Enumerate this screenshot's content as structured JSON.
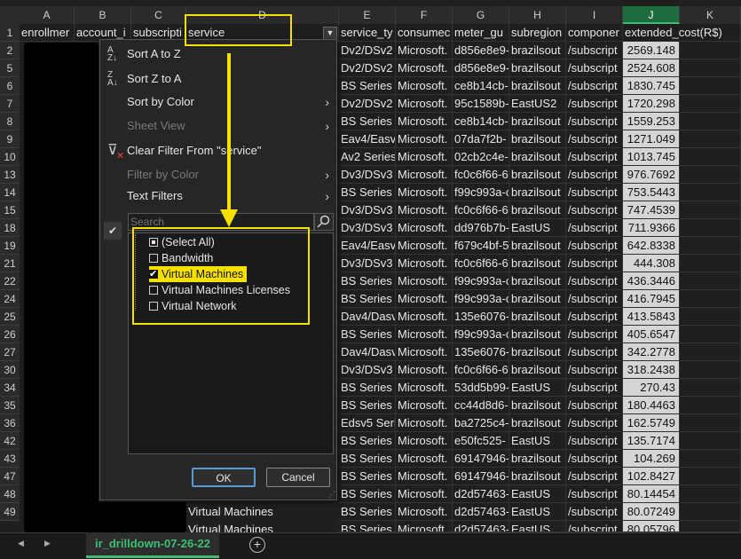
{
  "column_letters": [
    "A",
    "B",
    "C",
    "D",
    "E",
    "F",
    "G",
    "H",
    "I",
    "J",
    "K"
  ],
  "row_numbers": [
    "1",
    "2",
    "5",
    "6",
    "7",
    "8",
    "9",
    "10",
    "13",
    "14",
    "15",
    "18",
    "19",
    "21",
    "22",
    "24",
    "25",
    "26",
    "27",
    "30",
    "34",
    "35",
    "36",
    "42",
    "43",
    "47",
    "48",
    "49"
  ],
  "headers": {
    "A": "enrollmer",
    "B": "account_i",
    "C": "subscripti",
    "D": "service",
    "E": "service_ty",
    "F": "consumec",
    "G": "meter_gu",
    "H": "subregion",
    "I": "componer",
    "J": "extended_cost(R$)"
  },
  "rows": [
    [
      "Dv2/DSv2",
      "Microsoft.",
      "d856e8e9-",
      "brazilsout",
      "/subscript",
      "2569.148"
    ],
    [
      "Dv2/DSv2",
      "Microsoft.",
      "d856e8e9-",
      "brazilsout",
      "/subscript",
      "2524.608"
    ],
    [
      "BS Series",
      "Microsoft.",
      "ce8b14cb-",
      "brazilsout",
      "/subscript",
      "1830.745"
    ],
    [
      "Dv2/DSv2",
      "Microsoft.",
      "95c1589b-",
      "EastUS2",
      "/subscript",
      "1720.298"
    ],
    [
      "BS Series",
      "Microsoft.",
      "ce8b14cb-",
      "brazilsout",
      "/subscript",
      "1559.253"
    ],
    [
      "Eav4/Easv",
      "Microsoft.",
      "07da7f2b-",
      "brazilsout",
      "/subscript",
      "1271.049"
    ],
    [
      "Av2 Series",
      "Microsoft.",
      "02cb2c4e-",
      "brazilsout",
      "/subscript",
      "1013.745"
    ],
    [
      "Dv3/DSv3",
      "Microsoft.",
      "fc0c6f66-6",
      "brazilsout",
      "/subscript",
      "976.7692"
    ],
    [
      "BS Series",
      "Microsoft.",
      "f99c993a-c",
      "brazilsout",
      "/subscript",
      "753.5443"
    ],
    [
      "Dv3/DSv3",
      "Microsoft.",
      "fc0c6f66-6",
      "brazilsout",
      "/subscript",
      "747.4539"
    ],
    [
      "Dv3/DSv3",
      "Microsoft.",
      "dd976b7b-",
      "EastUS",
      "/subscript",
      "711.9366"
    ],
    [
      "Eav4/Easv",
      "Microsoft.",
      "f679c4bf-5",
      "brazilsout",
      "/subscript",
      "642.8338"
    ],
    [
      "Dv3/DSv3",
      "Microsoft.",
      "fc0c6f66-6",
      "brazilsout",
      "/subscript",
      "444.308"
    ],
    [
      "BS Series",
      "Microsoft.",
      "f99c993a-c",
      "brazilsout",
      "/subscript",
      "436.3446"
    ],
    [
      "BS Series",
      "Microsoft.",
      "f99c993a-c",
      "brazilsout",
      "/subscript",
      "416.7945"
    ],
    [
      "Dav4/Dasv",
      "Microsoft.",
      "135e6076-",
      "brazilsout",
      "/subscript",
      "413.5843"
    ],
    [
      "BS Series",
      "Microsoft.",
      "f99c993a-c",
      "brazilsout",
      "/subscript",
      "405.6547"
    ],
    [
      "Dav4/Dasv",
      "Microsoft.",
      "135e6076-",
      "brazilsout",
      "/subscript",
      "342.2778"
    ],
    [
      "Dv3/DSv3",
      "Microsoft.",
      "fc0c6f66-6",
      "brazilsout",
      "/subscript",
      "318.2438"
    ],
    [
      "BS Series",
      "Microsoft.",
      "53dd5b99-",
      "EastUS",
      "/subscript",
      "270.43"
    ],
    [
      "BS Series",
      "Microsoft.",
      "cc44d8d6-",
      "brazilsout",
      "/subscript",
      "180.4463"
    ],
    [
      "Edsv5 Seri",
      "Microsoft.",
      "ba2725c4-",
      "brazilsout",
      "/subscript",
      "162.5749"
    ],
    [
      "BS Series",
      "Microsoft.",
      "e50fc525-",
      "EastUS",
      "/subscript",
      "135.7174"
    ],
    [
      "BS Series",
      "Microsoft.",
      "69147946-",
      "brazilsout",
      "/subscript",
      "104.269"
    ],
    [
      "BS Series",
      "Microsoft.",
      "69147946-",
      "brazilsout",
      "/subscript",
      "102.8427"
    ],
    [
      "BS Series",
      "Microsoft.",
      "d2d57463-",
      "EastUS",
      "/subscript",
      "80.14454"
    ],
    [
      "BS Series",
      "Microsoft.",
      "d2d57463-",
      "EastUS",
      "/subscript",
      "80.07249"
    ],
    [
      "BS Series",
      "Microsoft.",
      "d2d57463-",
      "EastUS",
      "/subscript",
      "80.05796"
    ]
  ],
  "visible_service_cells": [
    "Virtual Machines",
    "Virtual Machines"
  ],
  "filter_menu": {
    "sort_az": "Sort A to Z",
    "sort_za": "Sort Z to A",
    "sort_by_color": "Sort by Color",
    "sheet_view": "Sheet View",
    "clear_filter": "Clear Filter From \"service\"",
    "filter_by_color": "Filter by Color",
    "text_filters": "Text Filters",
    "search_placeholder": "Search",
    "list": [
      {
        "label": "(Select All)",
        "state": "partial"
      },
      {
        "label": "Bandwidth",
        "state": "unchecked"
      },
      {
        "label": "Virtual Machines",
        "state": "checked"
      },
      {
        "label": "Virtual Machines Licenses",
        "state": "unchecked"
      },
      {
        "label": "Virtual Network",
        "state": "unchecked"
      }
    ],
    "ok_label": "OK",
    "cancel_label": "Cancel"
  },
  "sheet_tab": "ir_drilldown-07-26-22",
  "add_sheet_symbol": "+",
  "nav_prev": "◀",
  "nav_next": "▶",
  "colors": {
    "highlight": "#f5e000",
    "selected_col": "#1e6b3f",
    "accent": "#3fbf73"
  }
}
